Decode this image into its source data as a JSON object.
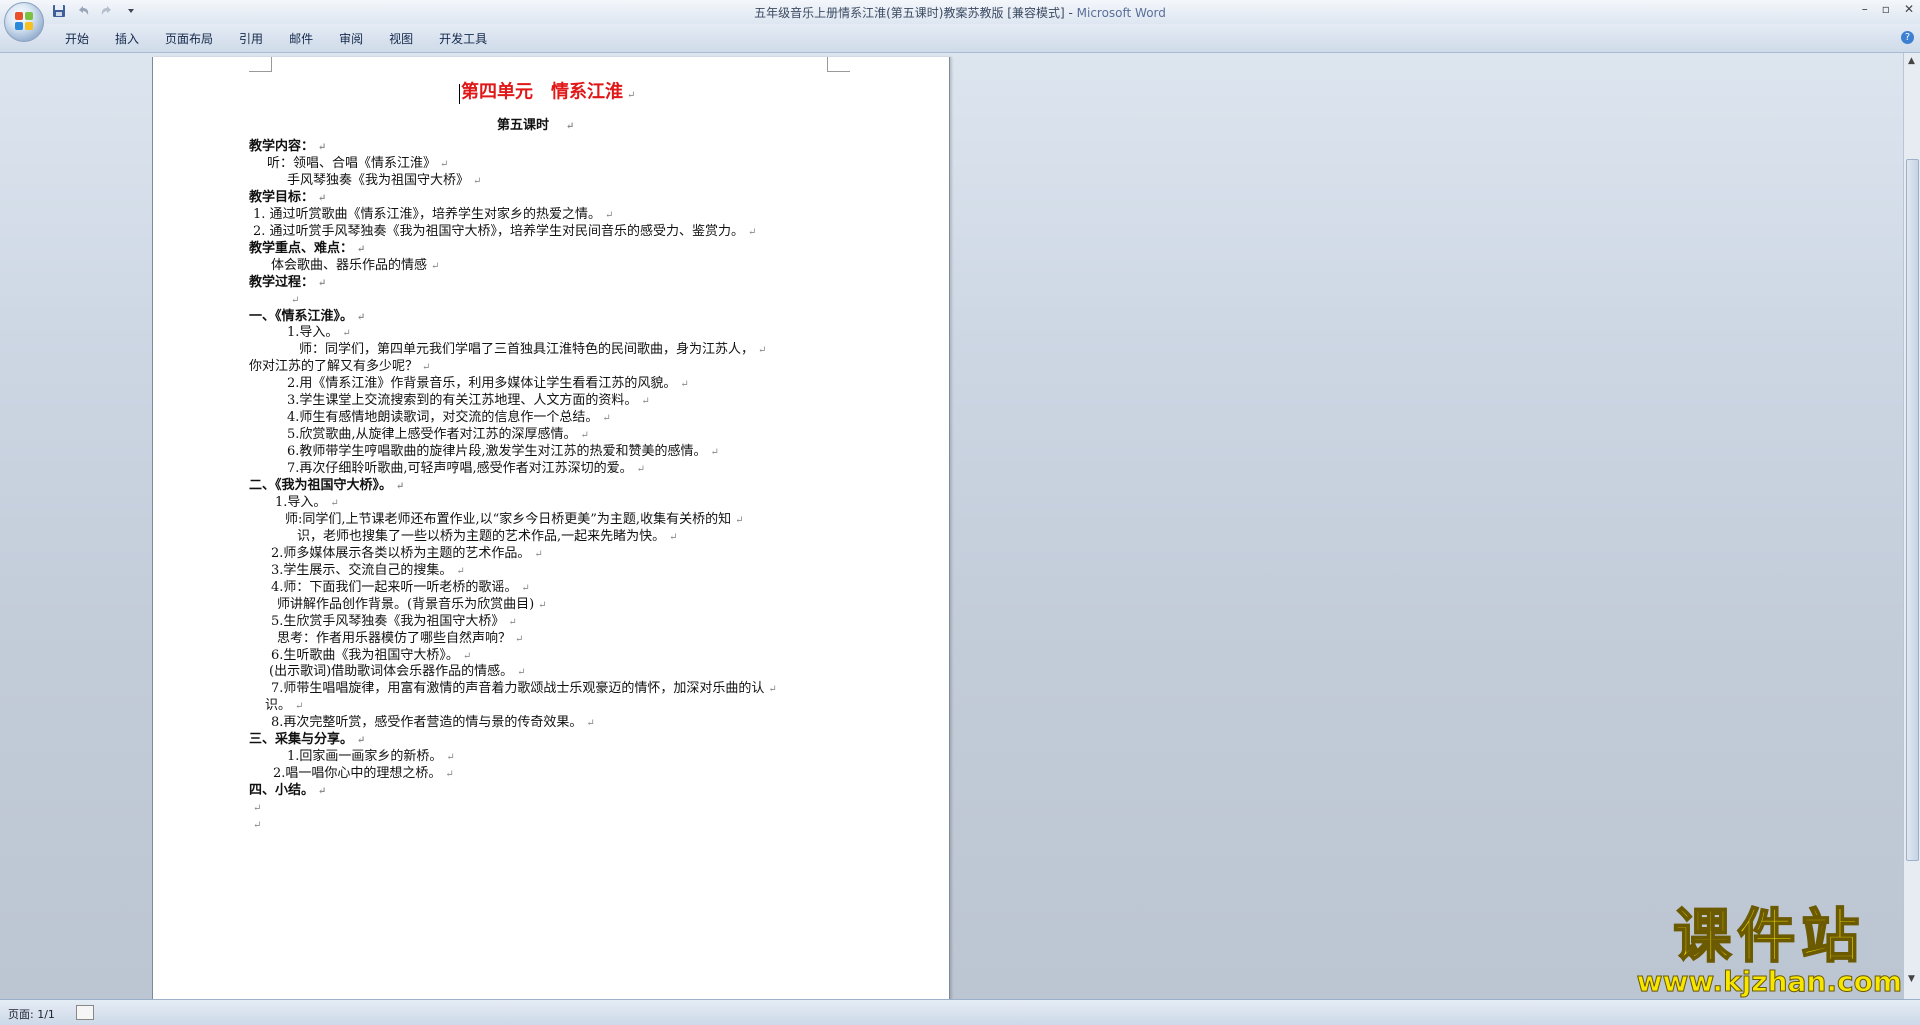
{
  "window": {
    "title": "五年级音乐上册情系江淮(第五课时)教案苏教版 [兼容模式]",
    "app_name": "Microsoft Word"
  },
  "quick_access": {
    "save_icon": "save-icon",
    "undo_icon": "undo-icon",
    "redo_icon": "redo-icon",
    "customize_icon": "chevron-down-icon"
  },
  "ribbon": {
    "tabs": [
      "开始",
      "插入",
      "页面布局",
      "引用",
      "邮件",
      "审阅",
      "视图",
      "开发工具"
    ]
  },
  "document": {
    "title": "第四单元　情系江淮",
    "subtitle": "第五课时　",
    "lines": [
      {
        "text": "教学内容：",
        "bold": true
      },
      {
        "text": "听：领唱、合唱《情系江淮》",
        "bold": false
      },
      {
        "text": "手风琴独奏《我为祖国守大桥》",
        "bold": false
      },
      {
        "text": "教学目标：",
        "bold": true
      },
      {
        "text": "1. 通过听赏歌曲《情系江淮》，培养学生对家乡的热爱之情。",
        "bold": false
      },
      {
        "text": "2. 通过听赏手风琴独奏《我为祖国守大桥》，培养学生对民间音乐的感受力、鉴赏力。",
        "bold": false
      },
      {
        "text": "教学重点、难点：",
        "bold": true
      },
      {
        "text": "体会歌曲、器乐作品的情感",
        "bold": false
      },
      {
        "text": "教学过程：",
        "bold": true
      },
      {
        "text": "",
        "bold": false
      },
      {
        "text": "一、《情系江淮》。",
        "bold": true
      },
      {
        "text": "1.导入。",
        "bold": false
      },
      {
        "text": "师：同学们，第四单元我们学唱了三首独具江淮特色的民间歌曲，身为江苏人，",
        "bold": false
      },
      {
        "text": "你对江苏的了解又有多少呢？",
        "bold": false
      },
      {
        "text": "2.用《情系江淮》作背景音乐，利用多媒体让学生看看江苏的风貌。",
        "bold": false
      },
      {
        "text": "3.学生课堂上交流搜索到的有关江苏地理、人文方面的资料。",
        "bold": false
      },
      {
        "text": "4.师生有感情地朗读歌词，对交流的信息作一个总结。",
        "bold": false
      },
      {
        "text": "5.欣赏歌曲,从旋律上感受作者对江苏的深厚感情。",
        "bold": false
      },
      {
        "text": "6.教师带学生哼唱歌曲的旋律片段,激发学生对江苏的热爱和赞美的感情。",
        "bold": false
      },
      {
        "text": "7.再次仔细聆听歌曲,可轻声哼唱,感受作者对江苏深切的爱。",
        "bold": false
      },
      {
        "text": "二、《我为祖国守大桥》。",
        "bold": true
      },
      {
        "text": "1.导入。",
        "bold": false
      },
      {
        "text": "师:同学们,上节课老师还布置作业,以“家乡今日桥更美”为主题,收集有关桥的知",
        "bold": false
      },
      {
        "text": "识，老师也搜集了一些以桥为主题的艺术作品,一起来先睹为快。",
        "bold": false
      },
      {
        "text": "2.师多媒体展示各类以桥为主题的艺术作品。",
        "bold": false
      },
      {
        "text": "3.学生展示、交流自己的搜集。",
        "bold": false
      },
      {
        "text": "4.师：下面我们一起来听一听老桥的歌谣。",
        "bold": false
      },
      {
        "text": "师讲解作品创作背景。(背景音乐为欣赏曲目)",
        "bold": false
      },
      {
        "text": "5.生欣赏手风琴独奏《我为祖国守大桥》",
        "bold": false
      },
      {
        "text": "思考：作者用乐器模仿了哪些自然声响？",
        "bold": false
      },
      {
        "text": "6.生听歌曲《我为祖国守大桥》。",
        "bold": false
      },
      {
        "text": "(出示歌词)借助歌词体会乐器作品的情感。",
        "bold": false
      },
      {
        "text": "7.师带生唱唱旋律，用富有激情的声音着力歌颂战士乐观豪迈的情怀，加深对乐曲的认",
        "bold": false
      },
      {
        "text": "识。",
        "bold": false
      },
      {
        "text": "8.再次完整听赏，感受作者营造的情与景的传奇效果。",
        "bold": false
      },
      {
        "text": "三、采集与分享。",
        "bold": true
      },
      {
        "text": "1.回家画一画家乡的新桥。",
        "bold": false
      },
      {
        "text": "2.唱一唱你心中的理想之桥。",
        "bold": false
      },
      {
        "text": "四、小结。",
        "bold": true
      },
      {
        "text": "",
        "bold": false
      },
      {
        "text": "",
        "bold": false
      }
    ],
    "paragraph_mark": "↵"
  },
  "statusbar": {
    "page_info": "页面: 1/1"
  },
  "watermark": {
    "text": "课件站",
    "url": "www.kjzhan.com"
  },
  "colors": {
    "title_red": "#e01818",
    "watermark_yellow": "#f7e600"
  }
}
